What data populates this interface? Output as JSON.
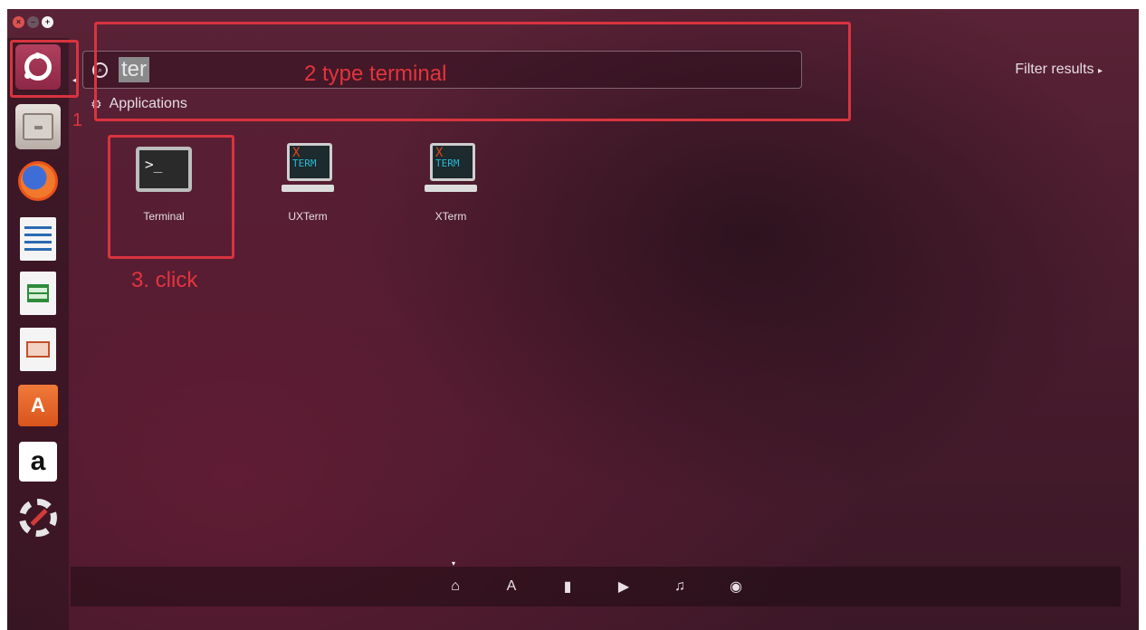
{
  "window": {
    "controls": [
      "close",
      "minimize",
      "maximize"
    ]
  },
  "launcher": {
    "items": [
      {
        "name": "dash-home",
        "icon": "ubuntu-logo-icon"
      },
      {
        "name": "files",
        "icon": "files-icon"
      },
      {
        "name": "firefox",
        "icon": "firefox-icon"
      },
      {
        "name": "libreoffice-writer",
        "icon": "writer-icon"
      },
      {
        "name": "libreoffice-calc",
        "icon": "calc-icon"
      },
      {
        "name": "libreoffice-impress",
        "icon": "impress-icon"
      },
      {
        "name": "ubuntu-software",
        "icon": "software-center-icon",
        "glyph": "A"
      },
      {
        "name": "amazon",
        "icon": "amazon-icon",
        "glyph": "a"
      },
      {
        "name": "system-settings",
        "icon": "settings-icon"
      }
    ]
  },
  "search": {
    "value": "ter"
  },
  "filter_results": {
    "label": "Filter results",
    "arrow": "▸"
  },
  "category": {
    "label": "Applications"
  },
  "results": [
    {
      "label": "Terminal",
      "prompt": ">_"
    },
    {
      "label": "UXTerm",
      "x": "X",
      "term": "TERM"
    },
    {
      "label": "XTerm",
      "x": "X",
      "term": "TERM"
    }
  ],
  "annotations": {
    "step1": "1",
    "step2": "2 type terminal",
    "step3": "3. click",
    "color": "#d8343f"
  },
  "lenses": [
    {
      "name": "home",
      "icon": "home-icon",
      "glyph": "⌂"
    },
    {
      "name": "applications",
      "icon": "applications-icon",
      "glyph": "A"
    },
    {
      "name": "files",
      "icon": "file-icon",
      "glyph": "▮"
    },
    {
      "name": "video",
      "icon": "video-icon",
      "glyph": "▶"
    },
    {
      "name": "music",
      "icon": "music-icon",
      "glyph": "♫"
    },
    {
      "name": "photos",
      "icon": "camera-icon",
      "glyph": "◉"
    }
  ]
}
